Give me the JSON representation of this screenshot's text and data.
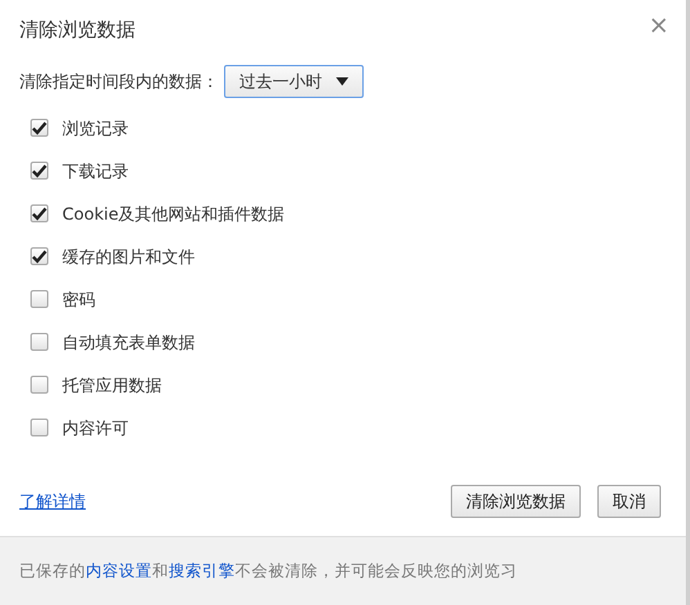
{
  "dialog": {
    "title": "清除浏览数据",
    "close": "×"
  },
  "time_range": {
    "label": "清除指定时间段内的数据：",
    "value": "过去一小时"
  },
  "options": [
    {
      "label": "浏览记录",
      "checked": true
    },
    {
      "label": "下载记录",
      "checked": true
    },
    {
      "label": "Cookie及其他网站和插件数据",
      "checked": true
    },
    {
      "label": "缓存的图片和文件",
      "checked": true
    },
    {
      "label": "密码",
      "checked": false
    },
    {
      "label": "自动填充表单数据",
      "checked": false
    },
    {
      "label": "托管应用数据",
      "checked": false
    },
    {
      "label": "内容许可",
      "checked": false
    }
  ],
  "learn_more": "了解详情",
  "buttons": [
    "清除浏览数据",
    "取消"
  ],
  "footer": [
    {
      "kind": "text",
      "text": "已保存的"
    },
    {
      "kind": "link",
      "text": "内容设置"
    },
    {
      "kind": "text",
      "text": "和"
    },
    {
      "kind": "link",
      "text": "搜索引擎"
    },
    {
      "kind": "text",
      "text": "不会被清除，并可能会反映您的浏览习"
    }
  ]
}
